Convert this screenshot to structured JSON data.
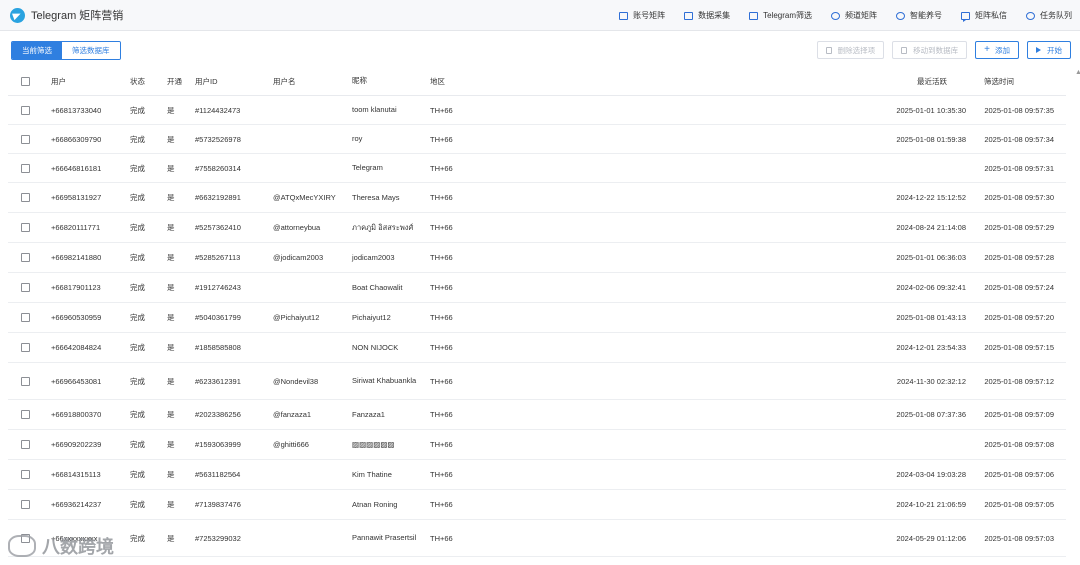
{
  "app": {
    "title": "Telegram 矩阵营销"
  },
  "nav": [
    {
      "label": "账号矩阵",
      "icon": "id-card-icon"
    },
    {
      "label": "数据采集",
      "icon": "database-icon"
    },
    {
      "label": "Telegram筛选",
      "icon": "hourglass-icon"
    },
    {
      "label": "频道矩阵",
      "icon": "broadcast-icon"
    },
    {
      "label": "智能养号",
      "icon": "robot-icon"
    },
    {
      "label": "矩阵私信",
      "icon": "chat-icon"
    },
    {
      "label": "任务队列",
      "icon": "refresh-icon"
    }
  ],
  "toolbar": {
    "tab_current": "当前筛选",
    "tab_library": "筛选数据库",
    "delete_label": "删除选择项",
    "move_label": "移动到数据库",
    "add_label": "添加",
    "start_label": "开始"
  },
  "table": {
    "headers": {
      "user": "用户",
      "status": "状态",
      "open": "开通",
      "uid": "用户ID",
      "username": "用户名",
      "nickname": "昵称",
      "region": "地区",
      "last_active": "最近活跃",
      "filter_time": "筛选时间"
    },
    "rows": [
      {
        "user": "+66813733040",
        "status": "完成",
        "open": "是",
        "uid": "#1124432473",
        "username": "",
        "nickname": "toom klanutai",
        "region": "TH+66",
        "last_active": "2025-01-01 10:35:30",
        "filter_time": "2025-01-08 09:57:35"
      },
      {
        "user": "+66866309790",
        "status": "完成",
        "open": "是",
        "uid": "#5732526978",
        "username": "",
        "nickname": "roy",
        "region": "TH+66",
        "last_active": "2025-01-08 01:59:38",
        "filter_time": "2025-01-08 09:57:34"
      },
      {
        "user": "+66646816181",
        "status": "完成",
        "open": "是",
        "uid": "#7558260314",
        "username": "",
        "nickname": "Telegram",
        "region": "TH+66",
        "last_active": "",
        "filter_time": "2025-01-08 09:57:31"
      },
      {
        "user": "+66958131927",
        "status": "完成",
        "open": "是",
        "uid": "#6632192891",
        "username": "@ATQxMecYXIRY",
        "nickname": "Theresa Mays",
        "region": "TH+66",
        "last_active": "2024-12-22 15:12:52",
        "filter_time": "2025-01-08 09:57:30"
      },
      {
        "user": "+66820111771",
        "status": "完成",
        "open": "是",
        "uid": "#5257362410",
        "username": "@attorneybua",
        "nickname": "ภาคภูมิ อิสสระพงศ์",
        "region": "TH+66",
        "last_active": "2024-08-24 21:14:08",
        "filter_time": "2025-01-08 09:57:29"
      },
      {
        "user": "+66982141880",
        "status": "完成",
        "open": "是",
        "uid": "#5285267113",
        "username": "@jodicam2003",
        "nickname": "jodicam2003",
        "region": "TH+66",
        "last_active": "2025-01-01 06:36:03",
        "filter_time": "2025-01-08 09:57:28"
      },
      {
        "user": "+66817901123",
        "status": "完成",
        "open": "是",
        "uid": "#1912746243",
        "username": "",
        "nickname": "Boat Chaowalit",
        "region": "TH+66",
        "last_active": "2024-02-06 09:32:41",
        "filter_time": "2025-01-08 09:57:24"
      },
      {
        "user": "+66960530959",
        "status": "完成",
        "open": "是",
        "uid": "#5040361799",
        "username": "@Pichaiyut12",
        "nickname": "Pichaiyut12",
        "region": "TH+66",
        "last_active": "2025-01-08 01:43:13",
        "filter_time": "2025-01-08 09:57:20"
      },
      {
        "user": "+66642084824",
        "status": "完成",
        "open": "是",
        "uid": "#1858585808",
        "username": "",
        "nickname": "NON NIJOCK",
        "region": "TH+66",
        "last_active": "2024-12-01 23:54:33",
        "filter_time": "2025-01-08 09:57:15"
      },
      {
        "user": "+66966453081",
        "status": "完成",
        "open": "是",
        "uid": "#6233612391",
        "username": "@Nondevil38",
        "nickname": "Siriwat Khabuankla",
        "region": "TH+66",
        "last_active": "2024-11-30 02:32:12",
        "filter_time": "2025-01-08 09:57:12"
      },
      {
        "user": "+66918800370",
        "status": "完成",
        "open": "是",
        "uid": "#2023386256",
        "username": "@fanzaza1",
        "nickname": "Fanzaza1",
        "region": "TH+66",
        "last_active": "2025-01-08 07:37:36",
        "filter_time": "2025-01-08 09:57:09"
      },
      {
        "user": "+66909202239",
        "status": "完成",
        "open": "是",
        "uid": "#1593063999",
        "username": "@ghitti666",
        "nickname": "▨▨▨▨▨▨",
        "region": "TH+66",
        "last_active": "",
        "filter_time": "2025-01-08 09:57:08"
      },
      {
        "user": "+66814315113",
        "status": "完成",
        "open": "是",
        "uid": "#5631182564",
        "username": "",
        "nickname": "Kim Thatine",
        "region": "TH+66",
        "last_active": "2024-03-04 19:03:28",
        "filter_time": "2025-01-08 09:57:06"
      },
      {
        "user": "+66936214237",
        "status": "完成",
        "open": "是",
        "uid": "#7139837476",
        "username": "",
        "nickname": "Atnan Roning",
        "region": "TH+66",
        "last_active": "2024-10-21 21:06:59",
        "filter_time": "2025-01-08 09:57:05"
      },
      {
        "user": "+66xxxxxxxxx",
        "status": "完成",
        "open": "是",
        "uid": "#7253299032",
        "username": "",
        "nickname": "Pannawit Prasertsil",
        "region": "TH+66",
        "last_active": "2024-05-29 01:12:06",
        "filter_time": "2025-01-08 09:57:03"
      }
    ]
  },
  "watermark": {
    "text": "八数跨境"
  },
  "colors": {
    "accent": "#2f7fe0",
    "telegram": "#2aa3e0"
  }
}
